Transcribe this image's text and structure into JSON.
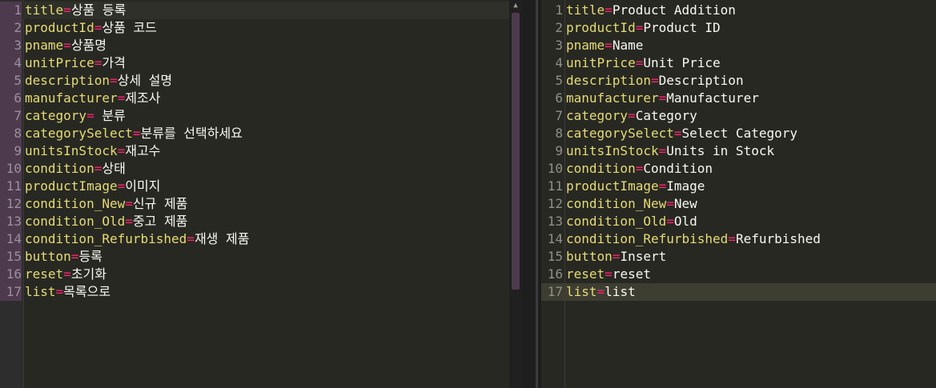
{
  "left_pane": {
    "lines": [
      {
        "num": "1",
        "key": "title",
        "eq": "=",
        "val": "상품 등록"
      },
      {
        "num": "2",
        "key": "productId",
        "eq": "=",
        "val": "상품 코드"
      },
      {
        "num": "3",
        "key": "pname",
        "eq": "=",
        "val": "상품명"
      },
      {
        "num": "4",
        "key": "unitPrice",
        "eq": "=",
        "val": "가격"
      },
      {
        "num": "5",
        "key": "description",
        "eq": "=",
        "val": "상세 설명"
      },
      {
        "num": "6",
        "key": "manufacturer",
        "eq": "=",
        "val": "제조사"
      },
      {
        "num": "7",
        "key": "category",
        "eq": "=",
        "val": " 분류"
      },
      {
        "num": "8",
        "key": "categorySelect",
        "eq": "=",
        "val": "분류를 선택하세요"
      },
      {
        "num": "9",
        "key": "unitsInStock",
        "eq": "=",
        "val": "재고수"
      },
      {
        "num": "10",
        "key": "condition",
        "eq": "=",
        "val": "상태"
      },
      {
        "num": "11",
        "key": "productImage",
        "eq": "=",
        "val": "이미지"
      },
      {
        "num": "12",
        "key": "condition_New",
        "eq": "=",
        "val": "신규 제품"
      },
      {
        "num": "13",
        "key": "condition_Old",
        "eq": "=",
        "val": "중고 제품"
      },
      {
        "num": "14",
        "key": "condition_Refurbished",
        "eq": "=",
        "val": "재생 제품"
      },
      {
        "num": "15",
        "key": "button",
        "eq": "=",
        "val": "등록"
      },
      {
        "num": "16",
        "key": "reset",
        "eq": "=",
        "val": "초기화"
      },
      {
        "num": "17",
        "key": "list",
        "eq": "=",
        "val": "목록으로"
      }
    ]
  },
  "right_pane": {
    "lines": [
      {
        "num": "1",
        "key": "title",
        "eq": "=",
        "val": "Product Addition"
      },
      {
        "num": "2",
        "key": "productId",
        "eq": "=",
        "val": "Product ID"
      },
      {
        "num": "3",
        "key": "pname",
        "eq": "=",
        "val": "Name"
      },
      {
        "num": "4",
        "key": "unitPrice",
        "eq": "=",
        "val": "Unit Price"
      },
      {
        "num": "5",
        "key": "description",
        "eq": "=",
        "val": "Description"
      },
      {
        "num": "6",
        "key": "manufacturer",
        "eq": "=",
        "val": "Manufacturer"
      },
      {
        "num": "7",
        "key": "category",
        "eq": "=",
        "val": "Category"
      },
      {
        "num": "8",
        "key": "categorySelect",
        "eq": "=",
        "val": "Select Category"
      },
      {
        "num": "9",
        "key": "unitsInStock",
        "eq": "=",
        "val": "Units in Stock"
      },
      {
        "num": "10",
        "key": "condition",
        "eq": "=",
        "val": "Condition"
      },
      {
        "num": "11",
        "key": "productImage",
        "eq": "=",
        "val": "Image"
      },
      {
        "num": "12",
        "key": "condition_New",
        "eq": "=",
        "val": "New"
      },
      {
        "num": "13",
        "key": "condition_Old",
        "eq": "=",
        "val": "Old"
      },
      {
        "num": "14",
        "key": "condition_Refurbished",
        "eq": "=",
        "val": "Refurbished"
      },
      {
        "num": "15",
        "key": "button",
        "eq": "=",
        "val": "Insert"
      },
      {
        "num": "16",
        "key": "reset",
        "eq": "=",
        "val": "reset"
      },
      {
        "num": "17",
        "key": "list",
        "eq": "=",
        "val": "list"
      }
    ]
  },
  "colors": {
    "background": "#272822",
    "key": "#e6db74",
    "equals": "#f92672",
    "value": "#f8f8f2",
    "line_number": "#8f908a",
    "left_gutter_highlight": "#4e3a4d",
    "current_line": "#3e3d32"
  },
  "icons": {
    "scroll_up": "chevron-up-icon"
  }
}
